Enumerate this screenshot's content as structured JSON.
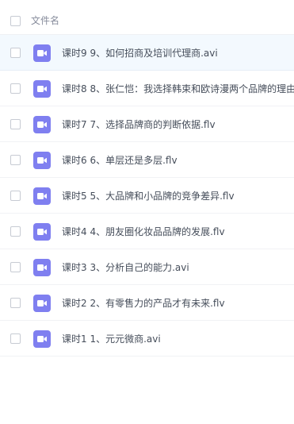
{
  "header": {
    "column_name": "文件名"
  },
  "files": [
    {
      "name": "课时9 9、如何招商及培训代理商.avi",
      "icon": "video-file-icon",
      "selected": true
    },
    {
      "name": "课时8 8、张仁恺：我选择韩束和欧诗漫两个品牌的理由",
      "icon": "video-file-icon",
      "selected": false
    },
    {
      "name": "课时7 7、选择品牌商的判断依据.flv",
      "icon": "video-file-icon",
      "selected": false
    },
    {
      "name": "课时6 6、单层还是多层.flv",
      "icon": "video-file-icon",
      "selected": false
    },
    {
      "name": "课时5 5、大品牌和小品牌的竞争差异.flv",
      "icon": "video-file-icon",
      "selected": false
    },
    {
      "name": "课时4 4、朋友圈化妆品品牌的发展.flv",
      "icon": "video-file-icon",
      "selected": false
    },
    {
      "name": "课时3 3、分析自己的能力.avi",
      "icon": "video-file-icon",
      "selected": false
    },
    {
      "name": "课时2 2、有零售力的产品才有未来.flv",
      "icon": "video-file-icon",
      "selected": false
    },
    {
      "name": "课时1 1、元元微商.avi",
      "icon": "video-file-icon",
      "selected": false
    }
  ],
  "colors": {
    "icon_bg": "#7f7ff0",
    "selected_row_bg": "#f3f9fe",
    "text": "#454d5a",
    "header_text": "#878c9c"
  }
}
